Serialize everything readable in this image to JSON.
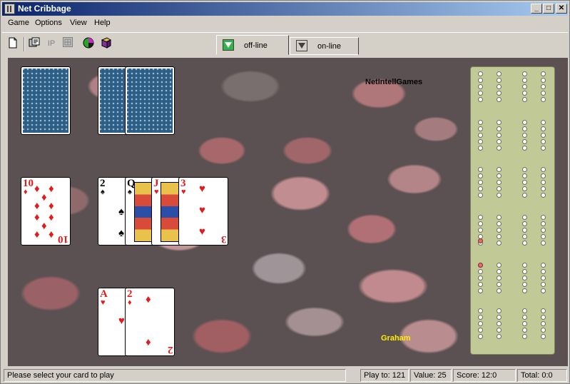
{
  "window": {
    "title": "Net Cribbage"
  },
  "menu": {
    "game": "Game",
    "options": "Options",
    "view": "View",
    "help": "Help"
  },
  "toolbar": {
    "ip_label": "IP"
  },
  "tabs": {
    "offline": "off-line",
    "online": "on-line"
  },
  "board": {
    "opponent_name": "NetIntellGames",
    "player_name": "Graham",
    "opponent_hand": "face-down",
    "crib": "face-down",
    "starter_card": {
      "rank": "10",
      "suit": "diamonds",
      "suit_glyph": "♦"
    },
    "played_cards": [
      {
        "rank": "2",
        "suit": "spades",
        "suit_glyph": "♠"
      },
      {
        "rank": "Q",
        "suit": "spades",
        "suit_glyph": "♠"
      },
      {
        "rank": "J",
        "suit": "hearts",
        "suit_glyph": "♥"
      },
      {
        "rank": "3",
        "suit": "hearts",
        "suit_glyph": "♥"
      }
    ],
    "player_hand": [
      {
        "rank": "A",
        "suit": "hearts",
        "suit_glyph": "♥"
      },
      {
        "rank": "2",
        "suit": "diamonds",
        "suit_glyph": "♦"
      }
    ]
  },
  "status": {
    "message": "Please select your card to play",
    "play_to": "Play to: 121",
    "value": "Value: 25",
    "score": "Score: 12:0",
    "total": "Total: 0:0"
  },
  "colors": {
    "accent_red": "#e31b1b",
    "cribboard": "#c1c997",
    "peg": "#e56b6b"
  }
}
